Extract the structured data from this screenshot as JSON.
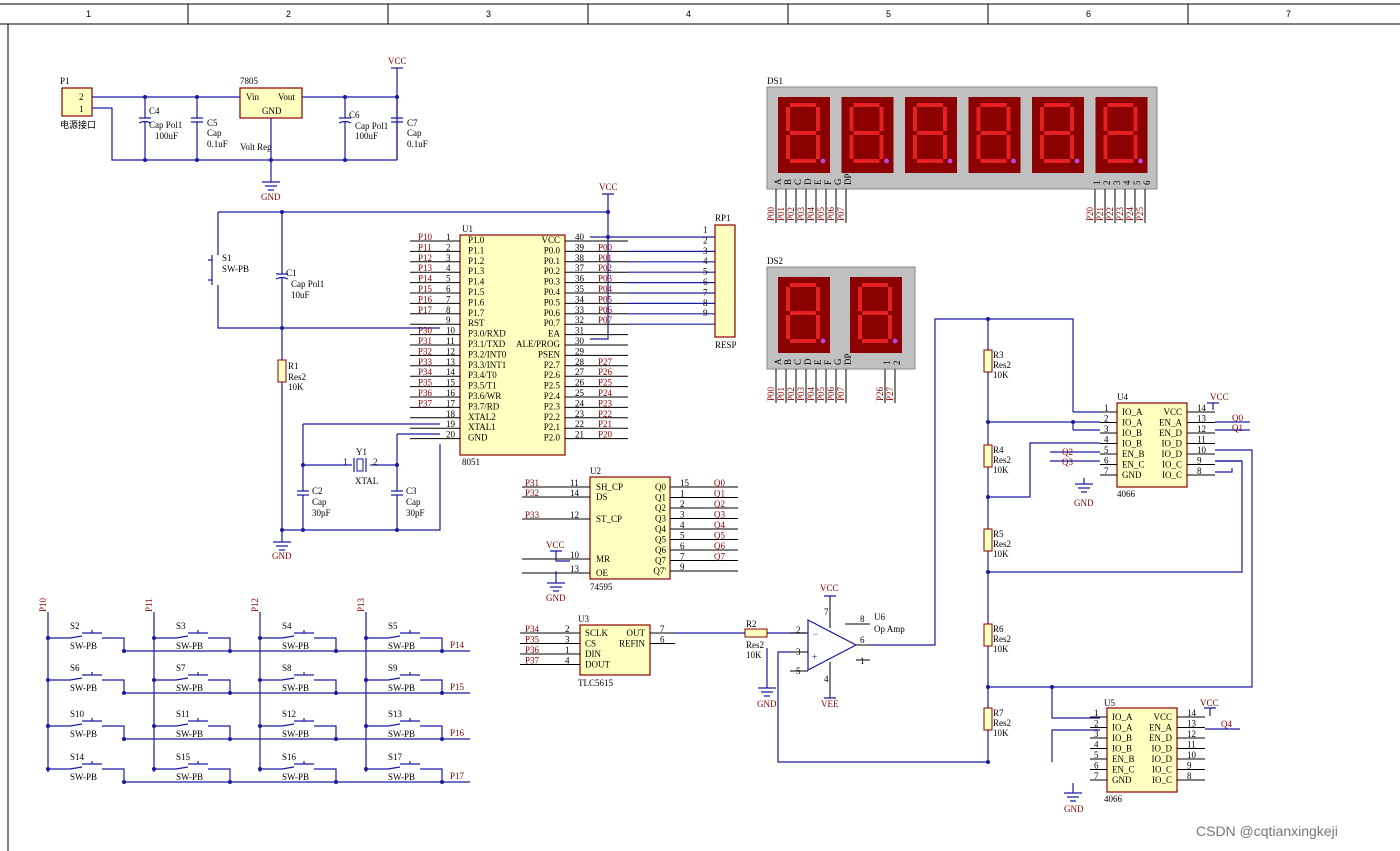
{
  "frame": {
    "columns": [
      "1",
      "2",
      "3",
      "4",
      "5",
      "6",
      "7"
    ]
  },
  "watermark": "CSDN @cqtianxingkeji",
  "power": {
    "p1": {
      "ref": "P1",
      "desc": "电源接口",
      "pins": [
        "2",
        "1"
      ]
    },
    "reg": {
      "ref": "7805",
      "vin": "Vin",
      "vout": "Vout",
      "gnd": "GND",
      "desc": "Volt Reg"
    },
    "c4": {
      "ref": "C4",
      "val": "Cap Pol1",
      "v2": "100uF"
    },
    "c5": {
      "ref": "C5",
      "val": "Cap",
      "v2": "0.1uF"
    },
    "c6": {
      "ref": "C6",
      "val": "Cap Pol1",
      "v2": "100uF"
    },
    "c7": {
      "ref": "C7",
      "val": "Cap",
      "v2": "0.1uF"
    },
    "vcc": "VCC",
    "gnd": "GND"
  },
  "reset": {
    "s1": {
      "ref": "S1",
      "val": "SW-PB"
    },
    "c1": {
      "ref": "C1",
      "val": "Cap Pol1",
      "v2": "10uF"
    },
    "r1": {
      "ref": "R1",
      "val": "Res2",
      "v2": "10K"
    },
    "y1": {
      "ref": "Y1",
      "val": "XTAL",
      "p1": "1",
      "p2": "2"
    },
    "c2": {
      "ref": "C2",
      "val": "Cap",
      "v2": "30pF"
    },
    "c3": {
      "ref": "C3",
      "val": "Cap",
      "v2": "30pF"
    }
  },
  "mcu": {
    "ref": "U1",
    "part": "8051",
    "left": [
      {
        "net": "P10",
        "num": "1",
        "name": "P1.0"
      },
      {
        "net": "P11",
        "num": "2",
        "name": "P1.1"
      },
      {
        "net": "P12",
        "num": "3",
        "name": "P1.2"
      },
      {
        "net": "P13",
        "num": "4",
        "name": "P1.3"
      },
      {
        "net": "P14",
        "num": "5",
        "name": "P1.4"
      },
      {
        "net": "P15",
        "num": "6",
        "name": "P1.5"
      },
      {
        "net": "P16",
        "num": "7",
        "name": "P1.6"
      },
      {
        "net": "P17",
        "num": "8",
        "name": "P1.7"
      },
      {
        "net": "",
        "num": "9",
        "name": "RST"
      },
      {
        "net": "P30",
        "num": "10",
        "name": "P3.0/RXD"
      },
      {
        "net": "P31",
        "num": "11",
        "name": "P3.1/TXD"
      },
      {
        "net": "P32",
        "num": "12",
        "name": "P3.2/INT0"
      },
      {
        "net": "P33",
        "num": "13",
        "name": "P3.3/INT1"
      },
      {
        "net": "P34",
        "num": "14",
        "name": "P3.4/T0"
      },
      {
        "net": "P35",
        "num": "15",
        "name": "P3.5/T1"
      },
      {
        "net": "P36",
        "num": "16",
        "name": "P3.6/WR"
      },
      {
        "net": "P37",
        "num": "17",
        "name": "P3.7/RD"
      },
      {
        "net": "",
        "num": "18",
        "name": "XTAL2"
      },
      {
        "net": "",
        "num": "19",
        "name": "XTAL1"
      },
      {
        "net": "",
        "num": "20",
        "name": "GND"
      }
    ],
    "right": [
      {
        "net": "",
        "num": "40",
        "name": "VCC"
      },
      {
        "net": "P00",
        "num": "39",
        "name": "P0.0"
      },
      {
        "net": "P01",
        "num": "38",
        "name": "P0.1"
      },
      {
        "net": "P02",
        "num": "37",
        "name": "P0.2"
      },
      {
        "net": "P03",
        "num": "36",
        "name": "P0.3"
      },
      {
        "net": "P04",
        "num": "35",
        "name": "P0.4"
      },
      {
        "net": "P05",
        "num": "34",
        "name": "P0.5"
      },
      {
        "net": "P06",
        "num": "33",
        "name": "P0.6"
      },
      {
        "net": "P07",
        "num": "32",
        "name": "P0.7"
      },
      {
        "net": "",
        "num": "31",
        "name": "EA"
      },
      {
        "net": "",
        "num": "30",
        "name": "ALE/PROG"
      },
      {
        "net": "",
        "num": "29",
        "name": "PSEN"
      },
      {
        "net": "P27",
        "num": "28",
        "name": "P2.7"
      },
      {
        "net": "P26",
        "num": "27",
        "name": "P2.6"
      },
      {
        "net": "P25",
        "num": "26",
        "name": "P2.5"
      },
      {
        "net": "P24",
        "num": "25",
        "name": "P2.4"
      },
      {
        "net": "P23",
        "num": "24",
        "name": "P2.3"
      },
      {
        "net": "P22",
        "num": "23",
        "name": "P2.2"
      },
      {
        "net": "P21",
        "num": "22",
        "name": "P2.1"
      },
      {
        "net": "P20",
        "num": "21",
        "name": "P2.0"
      }
    ]
  },
  "rp1": {
    "ref": "RP1",
    "val": "RESP",
    "pins": [
      "1",
      "2",
      "3",
      "4",
      "5",
      "6",
      "7",
      "8",
      "9"
    ]
  },
  "ds1": {
    "ref": "DS1",
    "segs": [
      "A",
      "B",
      "C",
      "D",
      "E",
      "F",
      "G",
      "DP"
    ],
    "digits": [
      "1",
      "2",
      "3",
      "4",
      "5",
      "6"
    ],
    "seg_nets": [
      "P00",
      "P01",
      "P02",
      "P03",
      "P04",
      "P05",
      "P06",
      "P07"
    ],
    "dig_nets": [
      "P20",
      "P21",
      "P22",
      "P23",
      "P24",
      "P25"
    ]
  },
  "ds2": {
    "ref": "DS2",
    "segs": [
      "A",
      "B",
      "C",
      "D",
      "E",
      "F",
      "G",
      "DP"
    ],
    "digits": [
      "1",
      "2"
    ],
    "seg_nets": [
      "P00",
      "P01",
      "P02",
      "P03",
      "P04",
      "P05",
      "P06",
      "P07"
    ],
    "dig_nets": [
      "P26",
      "P27"
    ]
  },
  "u2": {
    "ref": "U2",
    "part": "74595",
    "left": [
      {
        "net": "P31",
        "num": "11",
        "name": "SH_CP"
      },
      {
        "net": "P32",
        "num": "14",
        "name": "DS"
      },
      {
        "net": "P33",
        "num": "12",
        "name": "ST_CP"
      },
      {
        "net": "",
        "num": "10",
        "name": "MR"
      },
      {
        "net": "",
        "num": "13",
        "name": "OE"
      }
    ],
    "right": [
      {
        "net": "Q0",
        "num": "15",
        "name": "Q0"
      },
      {
        "net": "Q1",
        "num": "1",
        "name": "Q1"
      },
      {
        "net": "Q2",
        "num": "2",
        "name": "Q2"
      },
      {
        "net": "Q3",
        "num": "3",
        "name": "Q3"
      },
      {
        "net": "Q4",
        "num": "4",
        "name": "Q4"
      },
      {
        "net": "Q5",
        "num": "5",
        "name": "Q5"
      },
      {
        "net": "Q6",
        "num": "6",
        "name": "Q6"
      },
      {
        "net": "Q7",
        "num": "7",
        "name": "Q7"
      },
      {
        "net": "",
        "num": "9",
        "name": "Q7'"
      }
    ]
  },
  "u3": {
    "ref": "U3",
    "part": "TLC5615",
    "left": [
      {
        "net": "P34",
        "num": "2",
        "name": "SCLK"
      },
      {
        "net": "P35",
        "num": "3",
        "name": "CS"
      },
      {
        "net": "P36",
        "num": "1",
        "name": "DIN"
      },
      {
        "net": "P37",
        "num": "4",
        "name": "DOUT"
      }
    ],
    "right": [
      {
        "num": "7",
        "name": "OUT"
      },
      {
        "num": "6",
        "name": "REFIN"
      }
    ]
  },
  "r2": {
    "ref": "R2",
    "val": "Res2",
    "v2": "10K"
  },
  "u6": {
    "ref": "U6",
    "val": "Op Amp",
    "pins": [
      "2",
      "3",
      "5",
      "6",
      "1",
      "7",
      "4",
      "8"
    ],
    "vee": "VEE"
  },
  "ladder": [
    {
      "ref": "R3",
      "val": "Res2",
      "v2": "10K"
    },
    {
      "ref": "R4",
      "val": "Res2",
      "v2": "10K"
    },
    {
      "ref": "R5",
      "val": "Res2",
      "v2": "10K"
    },
    {
      "ref": "R6",
      "val": "Res2",
      "v2": "10K"
    },
    {
      "ref": "R7",
      "val": "Res2",
      "v2": "10K"
    }
  ],
  "u4": {
    "ref": "U4",
    "part": "4066",
    "left": [
      {
        "num": "1",
        "name": "IO_A"
      },
      {
        "num": "2",
        "name": "IO_A"
      },
      {
        "num": "3",
        "name": "IO_B"
      },
      {
        "num": "4",
        "name": "IO_B"
      },
      {
        "num": "5",
        "name": "EN_B"
      },
      {
        "num": "6",
        "name": "EN_C"
      },
      {
        "num": "7",
        "name": "GND"
      }
    ],
    "right": [
      {
        "num": "14",
        "name": "VCC"
      },
      {
        "num": "13",
        "name": "EN_A"
      },
      {
        "num": "12",
        "name": "EN_D"
      },
      {
        "num": "11",
        "name": "IO_D"
      },
      {
        "num": "10",
        "name": "IO_D"
      },
      {
        "num": "9",
        "name": "IO_C"
      },
      {
        "num": "8",
        "name": "IO_C"
      }
    ],
    "nets": {
      "q0": "Q0",
      "q1": "Q1",
      "q2": "Q2",
      "q3": "Q3"
    }
  },
  "u5": {
    "ref": "U5",
    "part": "4066",
    "left": [
      {
        "num": "1",
        "name": "IO_A"
      },
      {
        "num": "2",
        "name": "IO_A"
      },
      {
        "num": "3",
        "name": "IO_B"
      },
      {
        "num": "4",
        "name": "IO_B"
      },
      {
        "num": "5",
        "name": "EN_B"
      },
      {
        "num": "6",
        "name": "EN_C"
      },
      {
        "num": "7",
        "name": "GND"
      }
    ],
    "right": [
      {
        "num": "14",
        "name": "VCC"
      },
      {
        "num": "13",
        "name": "EN_A"
      },
      {
        "num": "12",
        "name": "EN_D"
      },
      {
        "num": "11",
        "name": "IO_D"
      },
      {
        "num": "10",
        "name": "IO_D"
      },
      {
        "num": "9",
        "name": "IO_C"
      },
      {
        "num": "8",
        "name": "IO_C"
      }
    ],
    "nets": {
      "q4": "Q4"
    }
  },
  "keypad": {
    "cols": [
      "P10",
      "P11",
      "P12",
      "P13"
    ],
    "rows": [
      "P14",
      "P15",
      "P16",
      "P17"
    ],
    "switches": [
      [
        "S2",
        "S3",
        "S4",
        "S5"
      ],
      [
        "S6",
        "S7",
        "S8",
        "S9"
      ],
      [
        "S10",
        "S11",
        "S12",
        "S13"
      ],
      [
        "S14",
        "S15",
        "S16",
        "S17"
      ]
    ],
    "val": "SW-PB"
  }
}
